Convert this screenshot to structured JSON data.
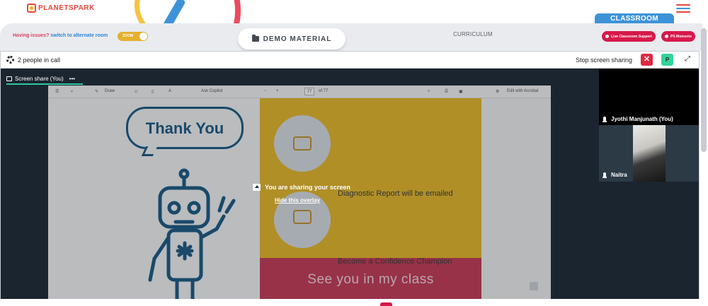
{
  "app": {
    "logo_text": "PLANETSPARK",
    "classroom_tab": "CLASSROOM"
  },
  "subbar": {
    "issue_text": "Having issues?",
    "alternate_link": "switch to alternate room",
    "zoom_label": "ZOOM",
    "demo_material": "DEMO MATERIAL",
    "curriculum": "CURRICULUM",
    "live_support": "Live Classroom Support",
    "ps_moments": "PS Moments"
  },
  "call": {
    "people_count": "2 people in call",
    "stop_sharing": "Stop screen sharing",
    "close_glyph": "✕",
    "participant_initial": "P",
    "share_tab_label": "Screen share (You)",
    "share_tab_more": "•••"
  },
  "doc_toolbar": {
    "draw": "Draw",
    "ask_copilot": "Ask Copilot",
    "page_current": "77",
    "page_total": "of 77",
    "edit_acrobat": "Edit with Acrobat"
  },
  "slide": {
    "thank_you": "Thank You",
    "diagnostic": "Diagnostic Report will be emailed",
    "confidence": "Become a Confidence Champion",
    "see_you": "See you in my class"
  },
  "overlay": {
    "sharing_message": "You are sharing your screen",
    "hide_overlay": "Hide this overlay"
  },
  "participants": [
    {
      "name": "Jyothi Manjunath (You)"
    },
    {
      "name": "Naitra"
    }
  ],
  "colors": {
    "accent_red": "#d7194a",
    "classroom_blue": "#3d93d8",
    "slide_yellow": "#e7b829",
    "slide_pink": "#c73a56",
    "share_green": "#2ec7a0"
  }
}
